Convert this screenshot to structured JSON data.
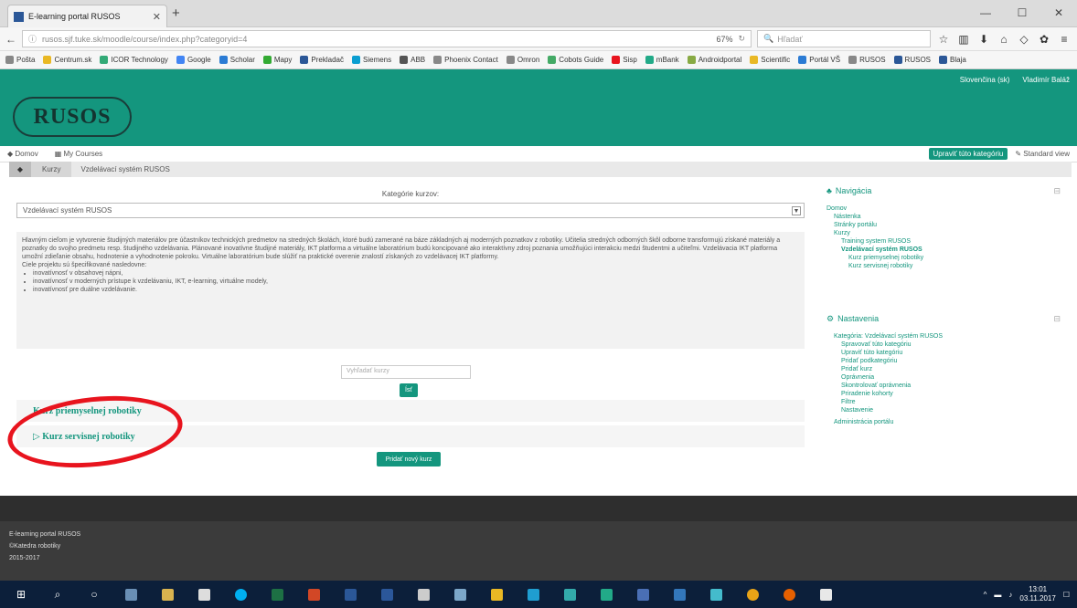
{
  "browser": {
    "tab_title": "E-learning portal RUSOS",
    "url_host": "tuke.sk",
    "url": "rusos.sjf.tuke.sk/moodle/course/index.php?categoryid=4",
    "zoom": "67%",
    "search_placeholder": "Hľadať",
    "bookmarks": [
      "Pošta",
      "Centrum.sk",
      "ICOR Technology",
      "Google",
      "Scholar",
      "Mapy",
      "Prekladač",
      "Siemens",
      "ABB",
      "Phoenix Contact",
      "Omron",
      "Cobots Guide",
      "Sisp",
      "mBank",
      "Androidportal",
      "Scientific",
      "Portál VŠ",
      "RUSOS",
      "RUSOS",
      "Blaja"
    ]
  },
  "site": {
    "top_links": [
      "Slovenčina (sk)",
      "Vladimír Baláž"
    ],
    "logo": "RUSOS",
    "nav": [
      "Domov",
      "My Courses"
    ],
    "edit_button": "Upraviť túto kategóriu",
    "standard_view": "Standard view",
    "breadcrumb": [
      "Kurzy",
      "Vzdelávací systém RUSOS"
    ]
  },
  "main": {
    "category_label": "Kategórie kurzov:",
    "category_selected": "Vzdelávací systém RUSOS",
    "description": "Hlavným cieľom je vytvorenie študijných materiálov pre účastníkov technických predmetov na stredných školách, ktoré budú zamerané na báze základných aj moderných poznatkov z robotiky. Učitelia stredných odborných škôl odborne transformujú získané materiály a poznatky do svojho predmetu resp. študijného vzdelávania. Plánované inovatívne študijné materiály, IKT platforma a virtuálne laboratórium budú koncipované ako interaktívny zdroj poznania umožňujúci interakciu medzi študentmi a učiteľmi. Vzdelávacia IKT platforma umožní zdieľanie obsahu, hodnotenie a vyhodnotenie pokroku. Virtuálne laboratórium bude slúžiť na praktické overenie znalostí získaných zo vzdelávacej IKT platformy.",
    "goals_title": "Ciele projektu sú špecifikované nasledovne:",
    "goals": [
      "inovatívnosť v obsahovej nápni,",
      "inovatívnosť v moderných prístupe k vzdelávaniu, IKT, e-learning, virtuálne modely,",
      "inovatívnosť pre duálne vzdelávanie."
    ],
    "search_placeholder": "Vyhľadať kurzy",
    "go_button": "Ísť",
    "courses": [
      "Kurz priemyselnej robotiky",
      "Kurz servisnej robotiky"
    ],
    "add_course_button": "Pridať nový kurz"
  },
  "sidebar": {
    "navigation_title": "Navigácia",
    "nav_items": [
      "Domov",
      "Nástenka",
      "Stránky portálu",
      "Kurzy",
      "Training system RUSOS",
      "Vzdelávací systém RUSOS",
      "Kurz priemyselnej robotiky",
      "Kurz servisnej robotiky"
    ],
    "admin_title": "Nastavenia",
    "admin_items": [
      "Kategória: Vzdelávací systém RUSOS",
      "Spravovať túto kategóriu",
      "Upraviť túto kategóriu",
      "Pridať podkategóriu",
      "Pridať kurz",
      "Oprávnenia",
      "Skontrolovať oprávnenia",
      "Priradenie kohorty",
      "Filtre",
      "Nastavenie",
      "Administrácia portálu"
    ]
  },
  "footer": {
    "lines": [
      "E-learning portal RUSOS",
      "©Katedra robotiky",
      "2015-2017"
    ]
  },
  "taskbar": {
    "time": "13:01",
    "date": "03.11.2017"
  }
}
